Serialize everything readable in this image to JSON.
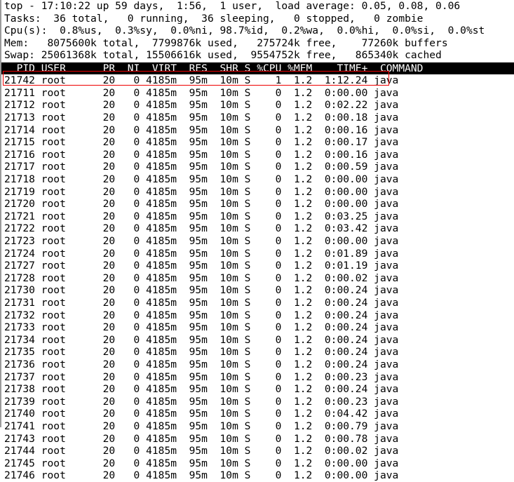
{
  "terminal": {
    "program": "top",
    "summary_lines": [
      "top - 17:10:22 up 59 days,  1:56,  1 user,  load average: 0.05, 0.08, 0.06",
      "Tasks:  36 total,   0 running,  36 sleeping,   0 stopped,   0 zombie",
      "Cpu(s):  0.8%us,  0.3%sy,  0.0%ni, 98.7%id,  0.2%wa,  0.0%hi,  0.0%si,  0.0%st",
      "Mem:   8075600k total,  7799876k used,   275724k free,    77260k buffers",
      "Swap: 25061368k total, 15506616k used,  9554752k free,   865340k cached"
    ],
    "summary": {
      "uptime_line": {
        "time": "17:10:22",
        "up": "59 days,  1:56",
        "users": "1 user",
        "load_average": "0.05, 0.08, 0.06"
      },
      "tasks": {
        "total": "36",
        "running": "0",
        "sleeping": "36",
        "stopped": "0",
        "zombie": "0"
      },
      "cpu": {
        "us": "0.8%",
        "sy": "0.3%",
        "ni": "0.0%",
        "id": "98.7%",
        "wa": "0.2%",
        "hi": "0.0%",
        "si": "0.0%",
        "st": "0.0%"
      },
      "mem": {
        "total": "8075600k",
        "used": "7799876k",
        "free": "275724k",
        "buffers": "77260k"
      },
      "swap": {
        "total": "25061368k",
        "used": "15506616k",
        "free": "9554752k",
        "cached": "865340k"
      }
    },
    "column_header_text": "  PID USER      PR  NI  VIRT  RES  SHR S %CPU %MEM    TIME+  COMMAND",
    "columns": [
      "PID",
      "USER",
      "PR",
      "NI",
      "VIRT",
      "RES",
      "SHR",
      "S",
      "%CPU",
      "%MEM",
      "TIME+",
      "COMMAND"
    ],
    "rows": [
      "21742 root      20   0 4185m  95m  10m S    1  1.2  1:12.24 java",
      "21711 root      20   0 4185m  95m  10m S    0  1.2  0:00.00 java",
      "21712 root      20   0 4185m  95m  10m S    0  1.2  0:02.22 java",
      "21713 root      20   0 4185m  95m  10m S    0  1.2  0:00.18 java",
      "21714 root      20   0 4185m  95m  10m S    0  1.2  0:00.16 java",
      "21715 root      20   0 4185m  95m  10m S    0  1.2  0:00.17 java",
      "21716 root      20   0 4185m  95m  10m S    0  1.2  0:00.16 java",
      "21717 root      20   0 4185m  95m  10m S    0  1.2  0:00.59 java",
      "21718 root      20   0 4185m  95m  10m S    0  1.2  0:00.00 java",
      "21719 root      20   0 4185m  95m  10m S    0  1.2  0:00.00 java",
      "21720 root      20   0 4185m  95m  10m S    0  1.2  0:00.00 java",
      "21721 root      20   0 4185m  95m  10m S    0  1.2  0:03.25 java",
      "21722 root      20   0 4185m  95m  10m S    0  1.2  0:03.42 java",
      "21723 root      20   0 4185m  95m  10m S    0  1.2  0:00.00 java",
      "21724 root      20   0 4185m  95m  10m S    0  1.2  0:01.89 java",
      "21727 root      20   0 4185m  95m  10m S    0  1.2  0:01.19 java",
      "21728 root      20   0 4185m  95m  10m S    0  1.2  0:00.02 java",
      "21730 root      20   0 4185m  95m  10m S    0  1.2  0:00.24 java",
      "21731 root      20   0 4185m  95m  10m S    0  1.2  0:00.24 java",
      "21732 root      20   0 4185m  95m  10m S    0  1.2  0:00.24 java",
      "21733 root      20   0 4185m  95m  10m S    0  1.2  0:00.24 java",
      "21734 root      20   0 4185m  95m  10m S    0  1.2  0:00.24 java",
      "21735 root      20   0 4185m  95m  10m S    0  1.2  0:00.24 java",
      "21736 root      20   0 4185m  95m  10m S    0  1.2  0:00.24 java",
      "21737 root      20   0 4185m  95m  10m S    0  1.2  0:00.23 java",
      "21738 root      20   0 4185m  95m  10m S    0  1.2  0:00.24 java",
      "21739 root      20   0 4185m  95m  10m S    0  1.2  0:00.23 java",
      "21740 root      20   0 4185m  95m  10m S    0  1.2  0:04.42 java",
      "21741 root      20   0 4185m  95m  10m S    0  1.2  0:00.79 java",
      "21743 root      20   0 4185m  95m  10m S    0  1.2  0:00.78 java",
      "21744 root      20   0 4185m  95m  10m S    0  1.2  0:00.02 java",
      "21745 root      20   0 4185m  95m  10m S    0  1.2  0:00.00 java",
      "21746 root      20   0 4185m  95m  10m S    0  1.2  0:00.00 java"
    ],
    "row_fields": [
      {
        "pid": "21742",
        "user": "root",
        "pr": "20",
        "ni": "0",
        "virt": "4185m",
        "res": "95m",
        "shr": "10m",
        "s": "S",
        "cpu": "1",
        "mem": "1.2",
        "time": "1:12.24",
        "command": "java"
      },
      {
        "pid": "21711",
        "user": "root",
        "pr": "20",
        "ni": "0",
        "virt": "4185m",
        "res": "95m",
        "shr": "10m",
        "s": "S",
        "cpu": "0",
        "mem": "1.2",
        "time": "0:00.00",
        "command": "java"
      },
      {
        "pid": "21712",
        "user": "root",
        "pr": "20",
        "ni": "0",
        "virt": "4185m",
        "res": "95m",
        "shr": "10m",
        "s": "S",
        "cpu": "0",
        "mem": "1.2",
        "time": "0:02.22",
        "command": "java"
      },
      {
        "pid": "21713",
        "user": "root",
        "pr": "20",
        "ni": "0",
        "virt": "4185m",
        "res": "95m",
        "shr": "10m",
        "s": "S",
        "cpu": "0",
        "mem": "1.2",
        "time": "0:00.18",
        "command": "java"
      },
      {
        "pid": "21714",
        "user": "root",
        "pr": "20",
        "ni": "0",
        "virt": "4185m",
        "res": "95m",
        "shr": "10m",
        "s": "S",
        "cpu": "0",
        "mem": "1.2",
        "time": "0:00.16",
        "command": "java"
      },
      {
        "pid": "21715",
        "user": "root",
        "pr": "20",
        "ni": "0",
        "virt": "4185m",
        "res": "95m",
        "shr": "10m",
        "s": "S",
        "cpu": "0",
        "mem": "1.2",
        "time": "0:00.17",
        "command": "java"
      },
      {
        "pid": "21716",
        "user": "root",
        "pr": "20",
        "ni": "0",
        "virt": "4185m",
        "res": "95m",
        "shr": "10m",
        "s": "S",
        "cpu": "0",
        "mem": "1.2",
        "time": "0:00.16",
        "command": "java"
      },
      {
        "pid": "21717",
        "user": "root",
        "pr": "20",
        "ni": "0",
        "virt": "4185m",
        "res": "95m",
        "shr": "10m",
        "s": "S",
        "cpu": "0",
        "mem": "1.2",
        "time": "0:00.59",
        "command": "java"
      },
      {
        "pid": "21718",
        "user": "root",
        "pr": "20",
        "ni": "0",
        "virt": "4185m",
        "res": "95m",
        "shr": "10m",
        "s": "S",
        "cpu": "0",
        "mem": "1.2",
        "time": "0:00.00",
        "command": "java"
      },
      {
        "pid": "21719",
        "user": "root",
        "pr": "20",
        "ni": "0",
        "virt": "4185m",
        "res": "95m",
        "shr": "10m",
        "s": "S",
        "cpu": "0",
        "mem": "1.2",
        "time": "0:00.00",
        "command": "java"
      },
      {
        "pid": "21720",
        "user": "root",
        "pr": "20",
        "ni": "0",
        "virt": "4185m",
        "res": "95m",
        "shr": "10m",
        "s": "S",
        "cpu": "0",
        "mem": "1.2",
        "time": "0:00.00",
        "command": "java"
      },
      {
        "pid": "21721",
        "user": "root",
        "pr": "20",
        "ni": "0",
        "virt": "4185m",
        "res": "95m",
        "shr": "10m",
        "s": "S",
        "cpu": "0",
        "mem": "1.2",
        "time": "0:03.25",
        "command": "java"
      },
      {
        "pid": "21722",
        "user": "root",
        "pr": "20",
        "ni": "0",
        "virt": "4185m",
        "res": "95m",
        "shr": "10m",
        "s": "S",
        "cpu": "0",
        "mem": "1.2",
        "time": "0:03.42",
        "command": "java"
      },
      {
        "pid": "21723",
        "user": "root",
        "pr": "20",
        "ni": "0",
        "virt": "4185m",
        "res": "95m",
        "shr": "10m",
        "s": "S",
        "cpu": "0",
        "mem": "1.2",
        "time": "0:00.00",
        "command": "java"
      },
      {
        "pid": "21724",
        "user": "root",
        "pr": "20",
        "ni": "0",
        "virt": "4185m",
        "res": "95m",
        "shr": "10m",
        "s": "S",
        "cpu": "0",
        "mem": "1.2",
        "time": "0:01.89",
        "command": "java"
      },
      {
        "pid": "21727",
        "user": "root",
        "pr": "20",
        "ni": "0",
        "virt": "4185m",
        "res": "95m",
        "shr": "10m",
        "s": "S",
        "cpu": "0",
        "mem": "1.2",
        "time": "0:01.19",
        "command": "java"
      },
      {
        "pid": "21728",
        "user": "root",
        "pr": "20",
        "ni": "0",
        "virt": "4185m",
        "res": "95m",
        "shr": "10m",
        "s": "S",
        "cpu": "0",
        "mem": "1.2",
        "time": "0:00.02",
        "command": "java"
      },
      {
        "pid": "21730",
        "user": "root",
        "pr": "20",
        "ni": "0",
        "virt": "4185m",
        "res": "95m",
        "shr": "10m",
        "s": "S",
        "cpu": "0",
        "mem": "1.2",
        "time": "0:00.24",
        "command": "java"
      },
      {
        "pid": "21731",
        "user": "root",
        "pr": "20",
        "ni": "0",
        "virt": "4185m",
        "res": "95m",
        "shr": "10m",
        "s": "S",
        "cpu": "0",
        "mem": "1.2",
        "time": "0:00.24",
        "command": "java"
      },
      {
        "pid": "21732",
        "user": "root",
        "pr": "20",
        "ni": "0",
        "virt": "4185m",
        "res": "95m",
        "shr": "10m",
        "s": "S",
        "cpu": "0",
        "mem": "1.2",
        "time": "0:00.24",
        "command": "java"
      },
      {
        "pid": "21733",
        "user": "root",
        "pr": "20",
        "ni": "0",
        "virt": "4185m",
        "res": "95m",
        "shr": "10m",
        "s": "S",
        "cpu": "0",
        "mem": "1.2",
        "time": "0:00.24",
        "command": "java"
      },
      {
        "pid": "21734",
        "user": "root",
        "pr": "20",
        "ni": "0",
        "virt": "4185m",
        "res": "95m",
        "shr": "10m",
        "s": "S",
        "cpu": "0",
        "mem": "1.2",
        "time": "0:00.24",
        "command": "java"
      },
      {
        "pid": "21735",
        "user": "root",
        "pr": "20",
        "ni": "0",
        "virt": "4185m",
        "res": "95m",
        "shr": "10m",
        "s": "S",
        "cpu": "0",
        "mem": "1.2",
        "time": "0:00.24",
        "command": "java"
      },
      {
        "pid": "21736",
        "user": "root",
        "pr": "20",
        "ni": "0",
        "virt": "4185m",
        "res": "95m",
        "shr": "10m",
        "s": "S",
        "cpu": "0",
        "mem": "1.2",
        "time": "0:00.24",
        "command": "java"
      },
      {
        "pid": "21737",
        "user": "root",
        "pr": "20",
        "ni": "0",
        "virt": "4185m",
        "res": "95m",
        "shr": "10m",
        "s": "S",
        "cpu": "0",
        "mem": "1.2",
        "time": "0:00.23",
        "command": "java"
      },
      {
        "pid": "21738",
        "user": "root",
        "pr": "20",
        "ni": "0",
        "virt": "4185m",
        "res": "95m",
        "shr": "10m",
        "s": "S",
        "cpu": "0",
        "mem": "1.2",
        "time": "0:00.24",
        "command": "java"
      },
      {
        "pid": "21739",
        "user": "root",
        "pr": "20",
        "ni": "0",
        "virt": "4185m",
        "res": "95m",
        "shr": "10m",
        "s": "S",
        "cpu": "0",
        "mem": "1.2",
        "time": "0:00.23",
        "command": "java"
      },
      {
        "pid": "21740",
        "user": "root",
        "pr": "20",
        "ni": "0",
        "virt": "4185m",
        "res": "95m",
        "shr": "10m",
        "s": "S",
        "cpu": "0",
        "mem": "1.2",
        "time": "0:04.42",
        "command": "java"
      },
      {
        "pid": "21741",
        "user": "root",
        "pr": "20",
        "ni": "0",
        "virt": "4185m",
        "res": "95m",
        "shr": "10m",
        "s": "S",
        "cpu": "0",
        "mem": "1.2",
        "time": "0:00.79",
        "command": "java"
      },
      {
        "pid": "21743",
        "user": "root",
        "pr": "20",
        "ni": "0",
        "virt": "4185m",
        "res": "95m",
        "shr": "10m",
        "s": "S",
        "cpu": "0",
        "mem": "1.2",
        "time": "0:00.78",
        "command": "java"
      },
      {
        "pid": "21744",
        "user": "root",
        "pr": "20",
        "ni": "0",
        "virt": "4185m",
        "res": "95m",
        "shr": "10m",
        "s": "S",
        "cpu": "0",
        "mem": "1.2",
        "time": "0:00.02",
        "command": "java"
      },
      {
        "pid": "21745",
        "user": "root",
        "pr": "20",
        "ni": "0",
        "virt": "4185m",
        "res": "95m",
        "shr": "10m",
        "s": "S",
        "cpu": "0",
        "mem": "1.2",
        "time": "0:00.00",
        "command": "java"
      },
      {
        "pid": "21746",
        "user": "root",
        "pr": "20",
        "ni": "0",
        "virt": "4185m",
        "res": "95m",
        "shr": "10m",
        "s": "S",
        "cpu": "0",
        "mem": "1.2",
        "time": "0:00.00",
        "command": "java"
      }
    ],
    "annotation": {
      "type": "rectangle",
      "color": "#ee0000",
      "target_pid": "21742"
    }
  }
}
